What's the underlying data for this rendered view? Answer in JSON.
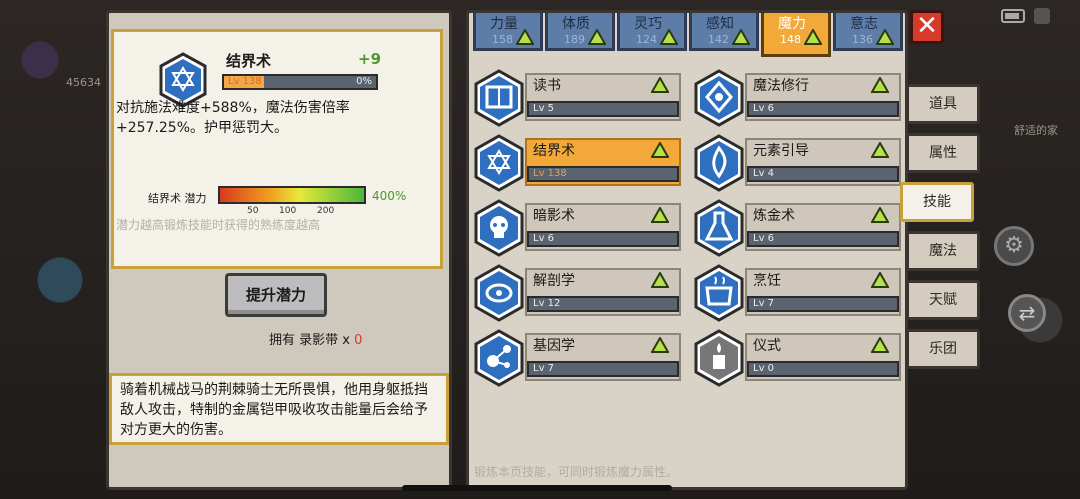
{
  "background": {
    "resource_count": "45634",
    "home_label": "舒适的家"
  },
  "detail": {
    "skill_name": "结界术",
    "bonus": "+9",
    "level": "Lv 138",
    "progress_text": "0%",
    "progress": 0,
    "description": "对抗施法难度+588%，魔法伤害倍率+257.25%。护甲惩罚大。",
    "potential_label": "结界术 潜力",
    "potential_ticks": [
      "50",
      "100",
      "200"
    ],
    "potential_pct": "400%",
    "potential_hint": "潜力越高锻炼技能时获得的熟练度越高",
    "icon": "hexagram-icon"
  },
  "raise_button": "提升潜力",
  "own": {
    "label": "拥有 录影带 x",
    "count": "0"
  },
  "lore": "骑着机械战马的荆棘骑士无所畏惧，他用身躯抵挡敌人攻击，特制的金属铠甲吸收攻击能量后会给予对方更大的伤害。",
  "attribute_tabs": [
    {
      "name": "力量",
      "value": "158"
    },
    {
      "name": "体质",
      "value": "189"
    },
    {
      "name": "灵巧",
      "value": "124"
    },
    {
      "name": "感知",
      "value": "142"
    },
    {
      "name": "魔力",
      "value": "148",
      "active": true
    },
    {
      "name": "意志",
      "value": "136"
    }
  ],
  "skills": [
    {
      "name": "读书",
      "level": "Lv 5",
      "icon": "book-icon"
    },
    {
      "name": "魔法修行",
      "level": "Lv 6",
      "icon": "rune-icon"
    },
    {
      "name": "结界术",
      "level": "Lv 138",
      "icon": "hexagram-icon",
      "selected": true
    },
    {
      "name": "元素引导",
      "level": "Lv 4",
      "icon": "flame-icon"
    },
    {
      "name": "暗影术",
      "level": "Lv 6",
      "icon": "skull-icon"
    },
    {
      "name": "炼金术",
      "level": "Lv 6",
      "icon": "flask-icon"
    },
    {
      "name": "解剖学",
      "level": "Lv 12",
      "icon": "meat-icon"
    },
    {
      "name": "烹饪",
      "level": "Lv 7",
      "icon": "pot-icon"
    },
    {
      "name": "基因学",
      "level": "Lv 7",
      "icon": "molecule-icon"
    },
    {
      "name": "仪式",
      "level": "Lv 0",
      "icon": "candle-icon"
    }
  ],
  "footer_hint": "锻炼本页技能，可同时锻炼魔力属性。",
  "side_tabs": [
    "道具",
    "属性",
    "技能",
    "魔法",
    "天赋",
    "乐团"
  ],
  "active_side_tab": "技能",
  "colors": {
    "accent": "#f2a93a",
    "tab_blue": "#5e7ca8",
    "positive": "#4a9a2a",
    "close": "#d63a2a"
  }
}
